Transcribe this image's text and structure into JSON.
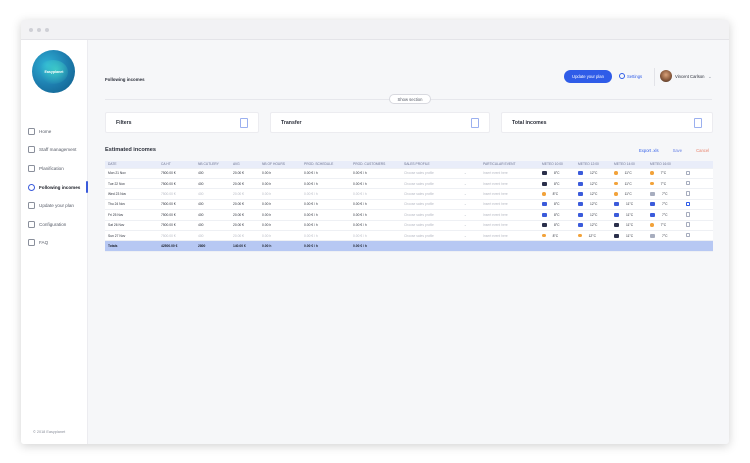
{
  "window": {
    "title": ""
  },
  "sidebar": {
    "logo_text": "Easyplanet",
    "items": [
      {
        "label": "Home",
        "icon": "home-icon",
        "active": false
      },
      {
        "label": "Staff management",
        "icon": "staff-icon",
        "active": false
      },
      {
        "label": "Planification",
        "icon": "calendar-icon",
        "active": false
      },
      {
        "label": "Following incomes",
        "icon": "incomes-icon",
        "active": true
      },
      {
        "label": "Update your plan",
        "icon": "chart-icon",
        "active": false
      },
      {
        "label": "Configuration",
        "icon": "gear-icon",
        "active": false
      },
      {
        "label": "FAQ",
        "icon": "help-icon",
        "active": false
      }
    ],
    "copyright": "© 2018 Easyplanet"
  },
  "header": {
    "page_title": "Following incomes",
    "plan_button": "Update your plan",
    "settings": "Settings",
    "user_name": "Vincent Carlson"
  },
  "show_section": "Show section",
  "cards": [
    {
      "label": "Filters"
    },
    {
      "label": "Transfer"
    },
    {
      "label": "Total incomes"
    }
  ],
  "section": {
    "title": "Estimated incomes",
    "export": "Export .xls",
    "save": "Save",
    "cancel": "Cancel"
  },
  "colors": {
    "accent": "#2f5ce8",
    "total_row": "#b7c8f3",
    "cancel": "#e8806a"
  },
  "table": {
    "headers": [
      "DATE",
      "CA HT",
      "NB CUTLERY",
      "AVG",
      "NB OF HOURS",
      "PROD. SCHEDULE",
      "PROD. CUSTOMERS",
      "SALES PROFILE",
      "PARTICULAR EVENT",
      "METEO 10:00",
      "METEO 12:00",
      "METEO 14:00",
      "METEO 16:00"
    ],
    "rows": [
      {
        "date": "Mon 21 Nov",
        "ca": "7500.00 €",
        "cut": "400",
        "avg": "20.00 €",
        "hours": "0.00 h",
        "sched": "0.00 € / h",
        "cust": "0.00 € / h",
        "profile": "Choose sales profile",
        "event": "Insert event here",
        "meteo": [
          [
            "storm",
            "8°C"
          ],
          [
            "rain",
            "12°C"
          ],
          [
            "sun",
            "11°C"
          ],
          [
            "sun",
            "7°C"
          ]
        ],
        "lock": "closed",
        "muted": false
      },
      {
        "date": "Tue 22 Nov",
        "ca": "7500.00 €",
        "cut": "400",
        "avg": "20.00 €",
        "hours": "0.00 h",
        "sched": "0.00 € / h",
        "cust": "0.00 € / h",
        "profile": "Choose sales profile",
        "event": "Insert event here",
        "meteo": [
          [
            "storm",
            "8°C"
          ],
          [
            "rain",
            "12°C"
          ],
          [
            "sun",
            "11°C"
          ],
          [
            "sun",
            "7°C"
          ]
        ],
        "lock": "closed",
        "muted": false
      },
      {
        "date": "Wed 23 Nov",
        "ca": "7500.00 €",
        "cut": "400",
        "avg": "20.00 €",
        "hours": "0.00 h",
        "sched": "0.00 € / h",
        "cust": "0.00 € / h",
        "profile": "Choose sales profile",
        "event": "Insert event here",
        "meteo": [
          [
            "sun",
            "8°C"
          ],
          [
            "rain",
            "12°C"
          ],
          [
            "sun",
            "11°C"
          ],
          [
            "fog",
            "7°C"
          ]
        ],
        "lock": "closed",
        "muted": true
      },
      {
        "date": "Thu 24 Nov",
        "ca": "7500.00 €",
        "cut": "400",
        "avg": "20.00 €",
        "hours": "0.00 h",
        "sched": "0.00 € / h",
        "cust": "0.00 € / h",
        "profile": "Choose sales profile",
        "event": "Insert event here",
        "meteo": [
          [
            "rain",
            "8°C"
          ],
          [
            "rain",
            "12°C"
          ],
          [
            "rain",
            "11°C"
          ],
          [
            "rain",
            "7°C"
          ]
        ],
        "lock": "open",
        "muted": false
      },
      {
        "date": "Fri 25 Nov",
        "ca": "7500.00 €",
        "cut": "400",
        "avg": "20.00 €",
        "hours": "0.00 h",
        "sched": "0.00 € / h",
        "cust": "0.00 € / h",
        "profile": "Choose sales profile",
        "event": "Insert event here",
        "meteo": [
          [
            "rain",
            "8°C"
          ],
          [
            "rain",
            "12°C"
          ],
          [
            "rain",
            "11°C"
          ],
          [
            "rain",
            "7°C"
          ]
        ],
        "lock": "closed",
        "muted": false
      },
      {
        "date": "Sat 26 Nov",
        "ca": "7500.00 €",
        "cut": "400",
        "avg": "20.00 €",
        "hours": "0.00 h",
        "sched": "0.00 € / h",
        "cust": "0.00 € / h",
        "profile": "Choose sales profile",
        "event": "Insert event here",
        "meteo": [
          [
            "storm",
            "8°C"
          ],
          [
            "rain",
            "12°C"
          ],
          [
            "storm",
            "11°C"
          ],
          [
            "sun",
            "7°C"
          ]
        ],
        "lock": "closed",
        "muted": false
      },
      {
        "date": "Sun 27 Nov",
        "ca": "7500.00 €",
        "cut": "400",
        "avg": "20.00 €",
        "hours": "0.00 h",
        "sched": "0.00 € / h",
        "cust": "0.00 € / h",
        "profile": "Choose sales profile",
        "event": "Insert event here",
        "meteo": [
          [
            "sun",
            "8°C"
          ],
          [
            "sun",
            "12°C"
          ],
          [
            "storm",
            "11°C"
          ],
          [
            "fog",
            "7°C"
          ]
        ],
        "lock": "closed",
        "muted": true
      }
    ],
    "totals": {
      "label": "Totals",
      "ca": "42500.00 €",
      "cut": "2800",
      "avg": "140.00 €",
      "hours": "0.00 h",
      "sched": "0.00 € / h",
      "cust": "0.00 € / h"
    }
  }
}
